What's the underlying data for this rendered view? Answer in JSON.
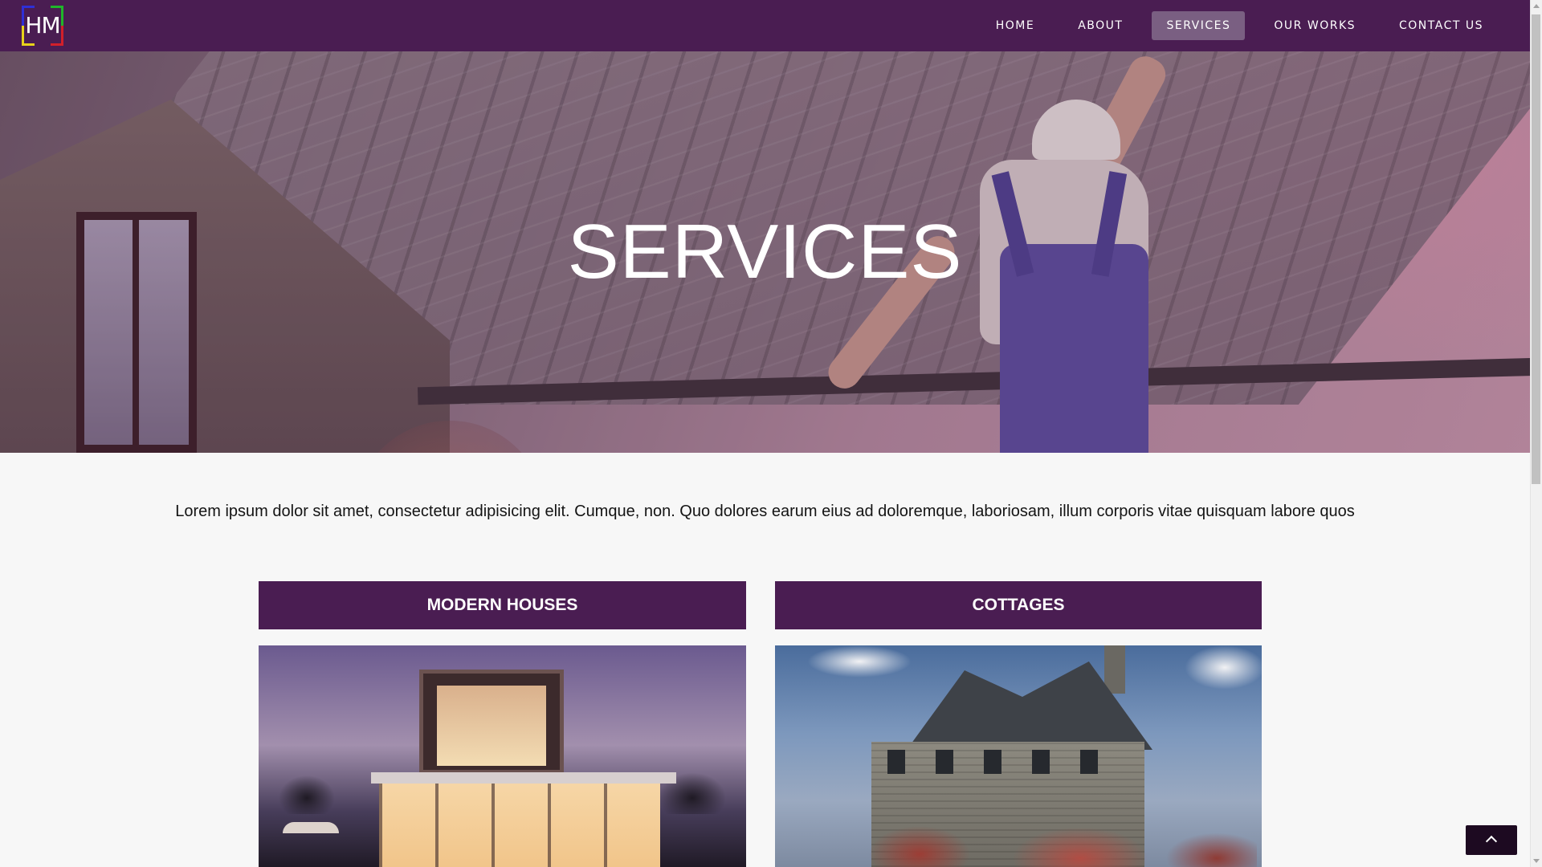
{
  "nav": {
    "logo_text": "HM",
    "links": [
      {
        "label": "HOME"
      },
      {
        "label": "ABOUT"
      },
      {
        "label": "SERVICES"
      },
      {
        "label": "OUR WORKS"
      },
      {
        "label": "CONTACT US"
      }
    ],
    "active": "SERVICES"
  },
  "hero": {
    "title": "SERVICES"
  },
  "intro": {
    "text": "Lorem ipsum dolor sit amet, consectetur adipisicing elit. Cumque, non. Quo dolores earum eius ad doloremque, laboriosam, illum corporis vitae quisquam labore quos"
  },
  "services": [
    {
      "title": "MODERN HOUSES"
    },
    {
      "title": "COTTAGES"
    }
  ],
  "colors": {
    "brand_purple": "#4a1d52",
    "active_nav": "#7a5f82",
    "back_to_top": "#1d0a21"
  },
  "icons": {
    "back_to_top": "chevron-up-icon"
  }
}
